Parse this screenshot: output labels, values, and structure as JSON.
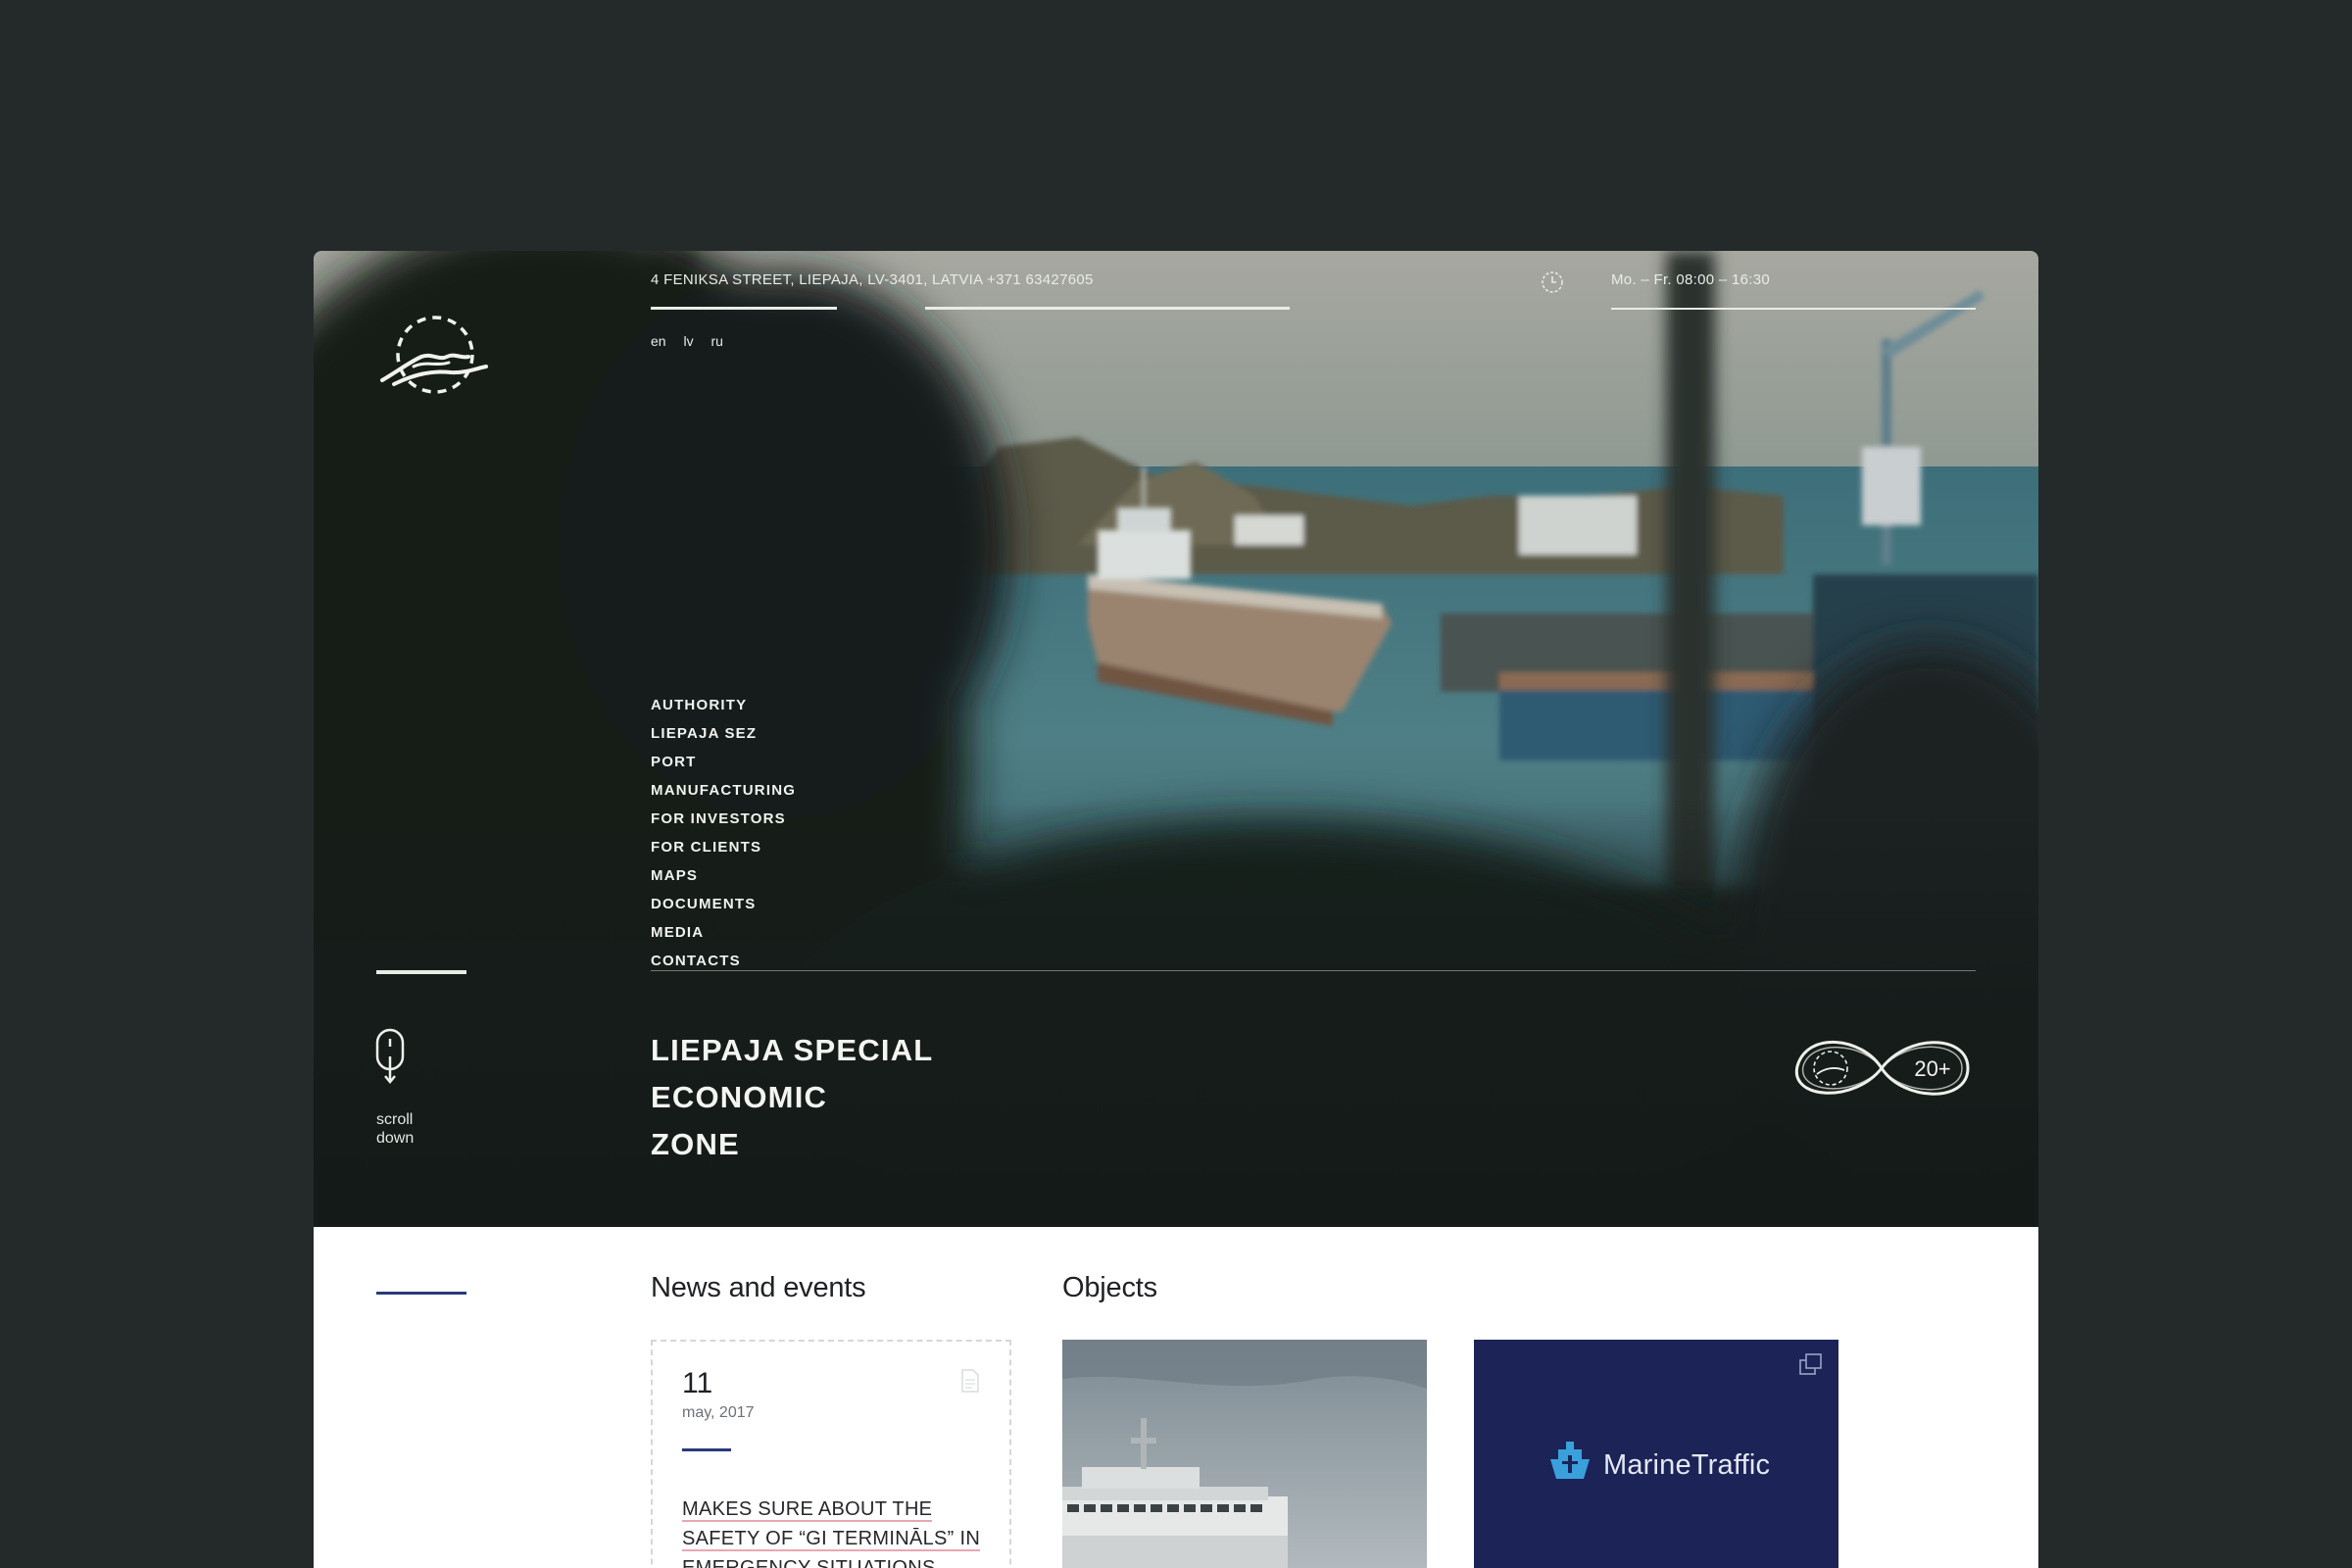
{
  "header": {
    "address": "4 FENIKSA STREET, LIEPAJA, LV-3401, LATVIA +371 63427605",
    "hours": "Mo. – Fr. 08:00 – 16:30"
  },
  "languages": [
    "en",
    "lv",
    "ru"
  ],
  "nav": {
    "items": [
      "AUTHORITY",
      "LIEPAJA SEZ",
      "PORT",
      "MANUFACTURING",
      "FOR INVESTORS",
      "FOR CLIENTS",
      "MAPS",
      "DOCUMENTS",
      "MEDIA",
      "CONTACTS"
    ]
  },
  "hero": {
    "title_line1": "LIEPAJA SPECIAL",
    "title_line2": "ECONOMIC",
    "title_line3": "ZONE",
    "scroll_line1": "scroll",
    "scroll_line2": "down",
    "badge_text": "20+"
  },
  "sections": {
    "news_heading": "News and events",
    "objects_heading": "Objects"
  },
  "news": {
    "day": "11",
    "month": "may, 2017",
    "title": "MAKES SURE ABOUT THE SAFETY OF “GI TERMINĀLS” IN EMERGENCY SITUATIONS"
  },
  "objects": {
    "marinetraffic_label": "MarineTraffic"
  },
  "colors": {
    "page_background": "#232a29",
    "accent_blue": "#283a7c",
    "marine_card": "#1b2357"
  }
}
